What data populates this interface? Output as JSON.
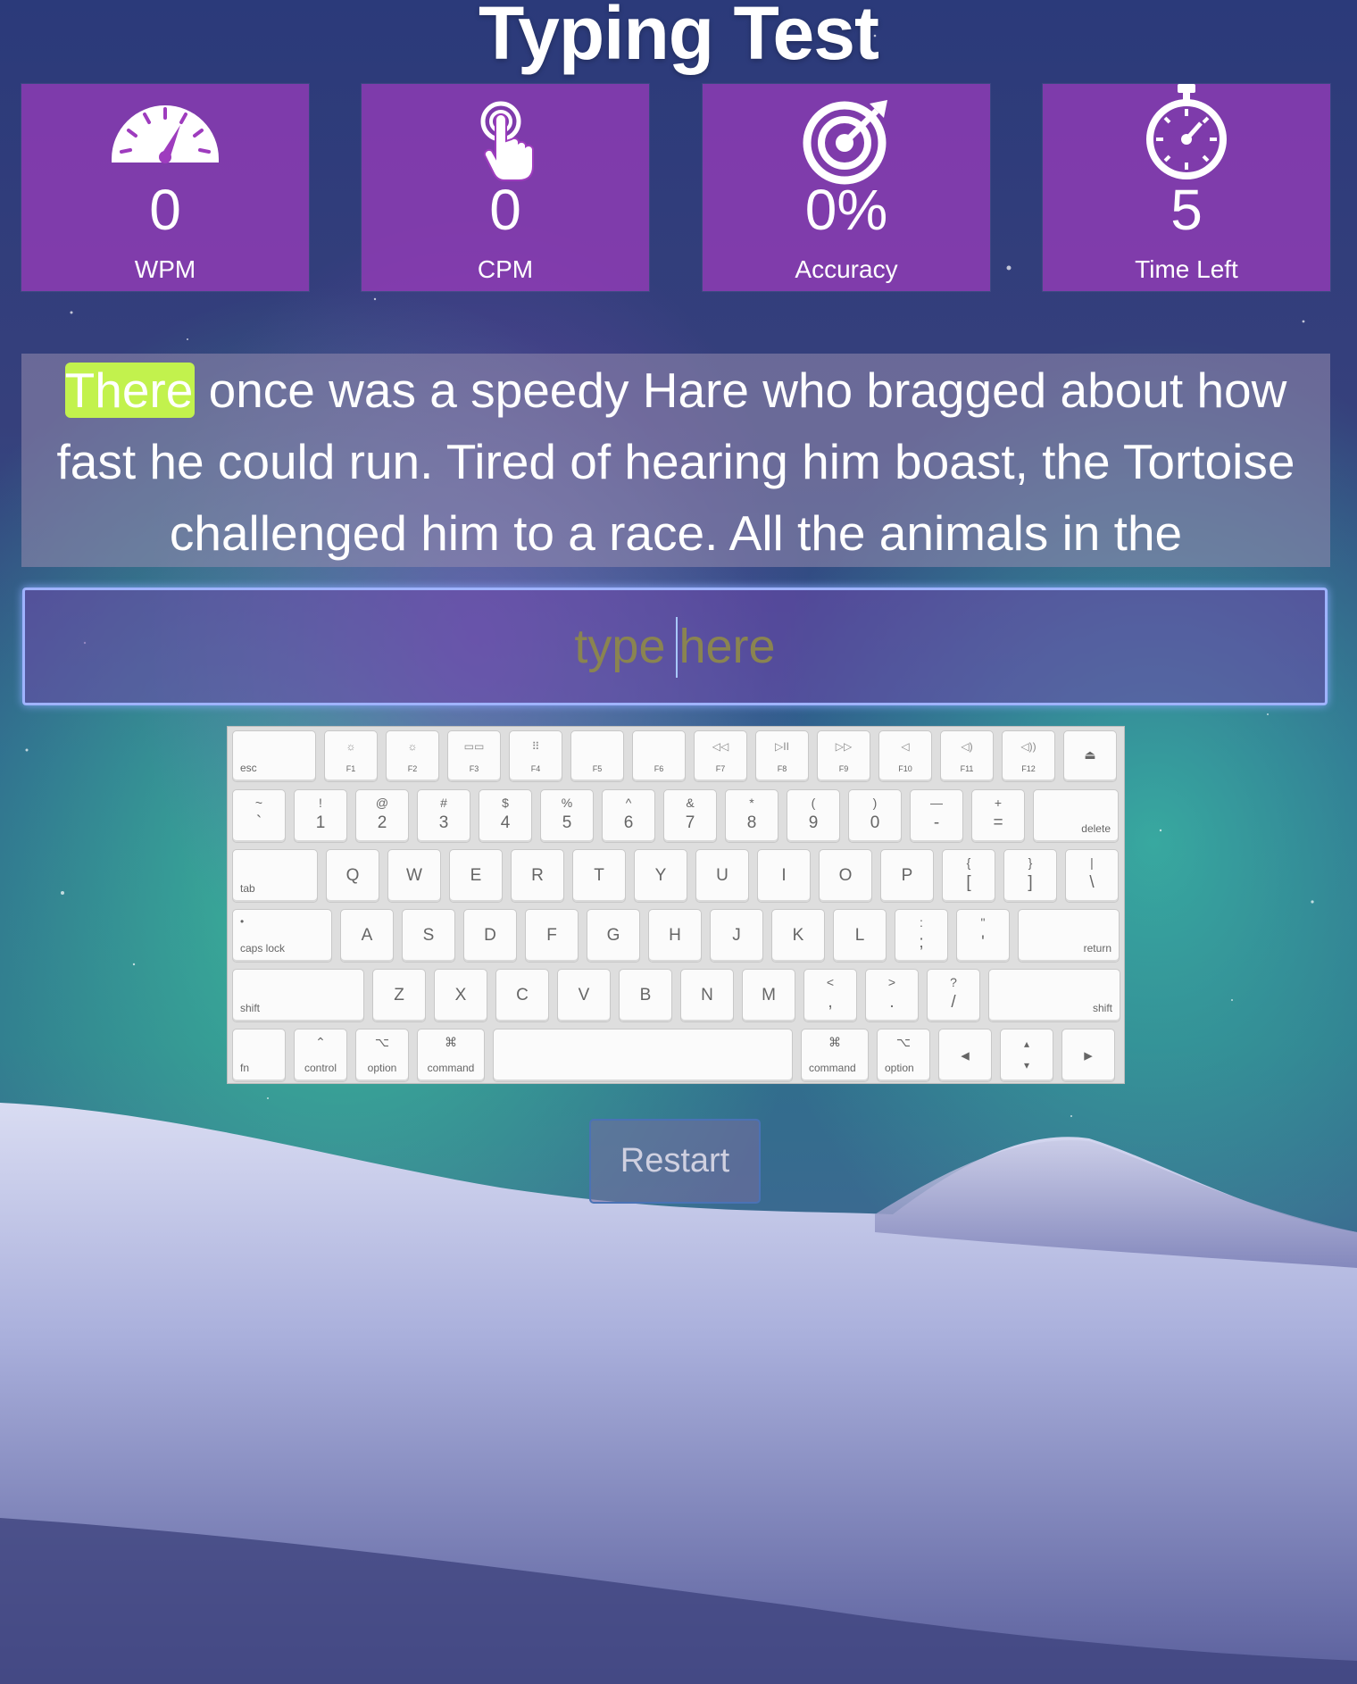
{
  "page": {
    "title": "Typing Test"
  },
  "stats": [
    {
      "icon": "speedometer-icon",
      "value": "0",
      "label": "WPM"
    },
    {
      "icon": "tap-finger-icon",
      "value": "0",
      "label": "CPM"
    },
    {
      "icon": "target-icon",
      "value": "0%",
      "label": "Accuracy"
    },
    {
      "icon": "stopwatch-icon",
      "value": "5",
      "label": "Time Left"
    }
  ],
  "passage": {
    "current_word": "There",
    "rest": " once was a speedy Hare who bragged about how fast he could run. Tired of hearing him boast, the Tortoise challenged him to a race. All the animals in the"
  },
  "colors": {
    "highlight": "#c2f24d",
    "stat_tile": "#9e3cbe",
    "input_border": "#9fb3ff"
  },
  "input": {
    "placeholder": "type here",
    "value": ""
  },
  "keyboard": {
    "row0": [
      {
        "main": "esc",
        "w": 94,
        "small": "bl"
      },
      {
        "main": "F1",
        "sym": "☼"
      },
      {
        "main": "F2",
        "sym": "☼"
      },
      {
        "main": "F3",
        "sym": "▭▭"
      },
      {
        "main": "F4",
        "sym": "⠿"
      },
      {
        "main": "F5",
        "sym": ""
      },
      {
        "main": "F6",
        "sym": ""
      },
      {
        "main": "F7",
        "sym": "◁◁"
      },
      {
        "main": "F8",
        "sym": "▷II"
      },
      {
        "main": "F9",
        "sym": "▷▷"
      },
      {
        "main": "F10",
        "sym": "◁"
      },
      {
        "main": "F11",
        "sym": "◁)"
      },
      {
        "main": "F12",
        "sym": "◁))"
      },
      {
        "main": "⏏",
        "w": 60,
        "sym_only": true
      }
    ],
    "row1": [
      {
        "up": "~",
        "main": "`"
      },
      {
        "up": "!",
        "main": "1"
      },
      {
        "up": "@",
        "main": "2"
      },
      {
        "up": "#",
        "main": "3"
      },
      {
        "up": "$",
        "main": "4"
      },
      {
        "up": "%",
        "main": "5"
      },
      {
        "up": "^",
        "main": "6"
      },
      {
        "up": "&",
        "main": "7"
      },
      {
        "up": "*",
        "main": "8"
      },
      {
        "up": "(",
        "main": "9"
      },
      {
        "up": ")",
        "main": "0"
      },
      {
        "up": "—",
        "main": "-"
      },
      {
        "up": "+",
        "main": "="
      },
      {
        "main": "delete",
        "w": 96,
        "small": "br"
      }
    ],
    "row2": [
      {
        "main": "tab",
        "w": 96,
        "small": "bl"
      },
      {
        "main": "Q"
      },
      {
        "main": "W"
      },
      {
        "main": "E"
      },
      {
        "main": "R"
      },
      {
        "main": "T"
      },
      {
        "main": "Y"
      },
      {
        "main": "U"
      },
      {
        "main": "I"
      },
      {
        "main": "O"
      },
      {
        "main": "P"
      },
      {
        "up": "{",
        "main": "["
      },
      {
        "up": "}",
        "main": "]"
      },
      {
        "up": "|",
        "main": "\\"
      }
    ],
    "row3": [
      {
        "main": "caps lock",
        "w": 112,
        "small": "bl",
        "dot": true
      },
      {
        "main": "A"
      },
      {
        "main": "S"
      },
      {
        "main": "D"
      },
      {
        "main": "F"
      },
      {
        "main": "G"
      },
      {
        "main": "H"
      },
      {
        "main": "J"
      },
      {
        "main": "K"
      },
      {
        "main": "L"
      },
      {
        "up": ":",
        "main": ";"
      },
      {
        "up": "\"",
        "main": "'"
      },
      {
        "main": "return",
        "w": 114,
        "small": "br"
      }
    ],
    "row4": [
      {
        "main": "shift",
        "w": 148,
        "small": "bl"
      },
      {
        "main": "Z"
      },
      {
        "main": "X"
      },
      {
        "main": "C"
      },
      {
        "main": "V"
      },
      {
        "main": "B"
      },
      {
        "main": "N"
      },
      {
        "main": "M"
      },
      {
        "up": "<",
        "main": ","
      },
      {
        "up": ">",
        "main": "."
      },
      {
        "up": "?",
        "main": "/"
      },
      {
        "main": "shift",
        "w": 148,
        "small": "br"
      }
    ],
    "row5": [
      {
        "main": "fn",
        "small": "bl"
      },
      {
        "main": "control",
        "up": "⌃",
        "small": "bc"
      },
      {
        "main": "option",
        "up": "⌥",
        "small": "bc"
      },
      {
        "main": "command",
        "up": "⌘",
        "w": 76,
        "small": "bc"
      },
      {
        "main": "",
        "w": 336
      },
      {
        "main": "command",
        "up": "⌘",
        "w": 76,
        "small": "bl"
      },
      {
        "main": "option",
        "up": "⌥",
        "small": "bl"
      },
      {
        "main": "◂"
      },
      {
        "main": "▴▾",
        "arrows": true
      },
      {
        "main": "▸"
      }
    ]
  },
  "restart": {
    "label": "Restart"
  }
}
